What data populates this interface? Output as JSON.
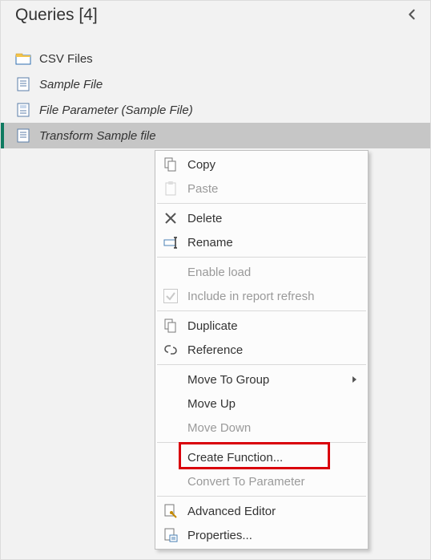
{
  "panel": {
    "title": "Queries [4]"
  },
  "queries": [
    {
      "label": "CSV Files"
    },
    {
      "label": "Sample File"
    },
    {
      "label": "File Parameter (Sample File)"
    },
    {
      "label": "Transform Sample file"
    }
  ],
  "menu": {
    "copy": "Copy",
    "paste": "Paste",
    "delete": "Delete",
    "rename": "Rename",
    "enable_load": "Enable load",
    "include_refresh": "Include in report refresh",
    "duplicate": "Duplicate",
    "reference": "Reference",
    "move_to_group": "Move To Group",
    "move_up": "Move Up",
    "move_down": "Move Down",
    "create_function": "Create Function...",
    "convert_parameter": "Convert To Parameter",
    "advanced_editor": "Advanced Editor",
    "properties": "Properties..."
  }
}
